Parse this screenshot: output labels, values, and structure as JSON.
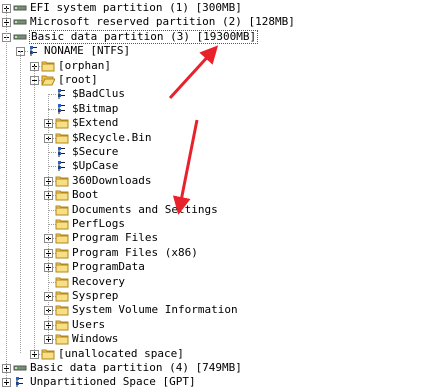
{
  "accent": "#e8212a",
  "folder_color": "#f3d36b",
  "items": [
    {
      "label": "EFI system partition (1) [300MB]",
      "icon": "partition-icon",
      "expander": "plus"
    },
    {
      "label": "Microsoft reserved partition (2) [128MB]",
      "icon": "partition-icon",
      "expander": "plus"
    },
    {
      "label": "Basic data partition (3) [19300MB]",
      "icon": "partition-icon",
      "expander": "minus"
    },
    {
      "label": "NONAME [NTFS]",
      "icon": "filesystem-icon",
      "expander": "minus"
    },
    {
      "label": "[orphan]",
      "icon": "folder-icon",
      "expander": "plus"
    },
    {
      "label": "[root]",
      "icon": "folder-open-icon",
      "expander": "minus"
    },
    {
      "label": "$BadClus",
      "icon": "metafile-icon",
      "expander": ""
    },
    {
      "label": "$Bitmap",
      "icon": "metafile-icon",
      "expander": ""
    },
    {
      "label": "$Extend",
      "icon": "folder-icon",
      "expander": "plus"
    },
    {
      "label": "$Recycle.Bin",
      "icon": "folder-icon",
      "expander": "plus"
    },
    {
      "label": "$Secure",
      "icon": "metafile-icon",
      "expander": ""
    },
    {
      "label": "$UpCase",
      "icon": "metafile-icon",
      "expander": ""
    },
    {
      "label": "360Downloads",
      "icon": "folder-icon",
      "expander": "plus"
    },
    {
      "label": "Boot",
      "icon": "folder-icon",
      "expander": "plus"
    },
    {
      "label": "Documents and Settings",
      "icon": "folder-icon",
      "expander": ""
    },
    {
      "label": "PerfLogs",
      "icon": "folder-icon",
      "expander": ""
    },
    {
      "label": "Program Files",
      "icon": "folder-icon",
      "expander": "plus"
    },
    {
      "label": "Program Files (x86)",
      "icon": "folder-icon",
      "expander": "plus"
    },
    {
      "label": "ProgramData",
      "icon": "folder-icon",
      "expander": "plus"
    },
    {
      "label": "Recovery",
      "icon": "folder-icon",
      "expander": ""
    },
    {
      "label": "Sysprep",
      "icon": "folder-icon",
      "expander": "plus"
    },
    {
      "label": "System Volume Information",
      "icon": "folder-icon",
      "expander": "plus"
    },
    {
      "label": "Users",
      "icon": "folder-icon",
      "expander": "plus"
    },
    {
      "label": "Windows",
      "icon": "folder-icon",
      "expander": "plus"
    },
    {
      "label": "[unallocated space]",
      "icon": "folder-icon",
      "expander": "plus"
    },
    {
      "label": "Basic data partition (4) [749MB]",
      "icon": "partition-icon",
      "expander": "plus"
    },
    {
      "label": "Unpartitioned Space [GPT]",
      "icon": "filesystem-icon",
      "expander": "plus"
    }
  ]
}
